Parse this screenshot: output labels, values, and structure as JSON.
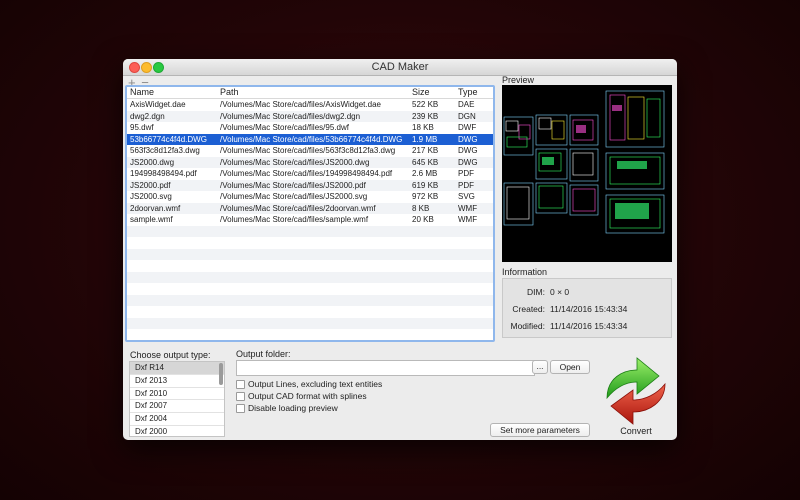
{
  "window": {
    "title": "CAD Maker",
    "toolbar": {
      "add_symbol": "+",
      "remove_symbol": "−"
    }
  },
  "file_table": {
    "columns": [
      "Name",
      "Path",
      "Size",
      "Type"
    ],
    "rows": [
      [
        "AxisWidget.dae",
        "/Volumes/Mac Store/cad/files/AxisWidget.dae",
        "522 KB",
        "DAE"
      ],
      [
        "dwg2.dgn",
        "/Volumes/Mac Store/cad/files/dwg2.dgn",
        "239 KB",
        "DGN"
      ],
      [
        "95.dwf",
        "/Volumes/Mac Store/cad/files/95.dwf",
        "18 KB",
        "DWF"
      ],
      [
        "53b66774c4f4d.DWG",
        "/Volumes/Mac Store/cad/files/53b66774c4f4d.DWG",
        "1.9 MB",
        "DWG"
      ],
      [
        "563f3c8d12fa3.dwg",
        "/Volumes/Mac Store/cad/files/563f3c8d12fa3.dwg",
        "217 KB",
        "DWG"
      ],
      [
        "JS2000.dwg",
        "/Volumes/Mac Store/cad/files/JS2000.dwg",
        "645 KB",
        "DWG"
      ],
      [
        "194998498494.pdf",
        "/Volumes/Mac Store/cad/files/194998498494.pdf",
        "2.6 MB",
        "PDF"
      ],
      [
        "JS2000.pdf",
        "/Volumes/Mac Store/cad/files/JS2000.pdf",
        "619 KB",
        "PDF"
      ],
      [
        "JS2000.svg",
        "/Volumes/Mac Store/cad/files/JS2000.svg",
        "972 KB",
        "SVG"
      ],
      [
        "2doorvan.wmf",
        "/Volumes/Mac Store/cad/files/2doorvan.wmf",
        "8 KB",
        "WMF"
      ],
      [
        "sample.wmf",
        "/Volumes/Mac Store/cad/files/sample.wmf",
        "20 KB",
        "WMF"
      ]
    ],
    "selected_row": 3,
    "empty_rows": 10
  },
  "preview": {
    "label": "Preview"
  },
  "information": {
    "label": "Information",
    "rows": [
      {
        "key": "DIM:",
        "value": "0 × 0"
      },
      {
        "key": "Created:",
        "value": "11/14/2016 15:43:34"
      },
      {
        "key": "Modified:",
        "value": "11/14/2016 15:43:34"
      }
    ]
  },
  "output_type": {
    "label": "Choose output type:",
    "options": [
      "Dxf R14",
      "Dxf 2013",
      "Dxf 2010",
      "Dxf 2007",
      "Dxf 2004",
      "Dxf 2000"
    ],
    "selected": 0
  },
  "output_folder": {
    "label": "Output folder:",
    "value": "",
    "browse_label": "...",
    "open_label": "Open"
  },
  "options": [
    {
      "label": "Output Lines, excluding text entities",
      "checked": false
    },
    {
      "label": "Output CAD format with splines",
      "checked": false
    },
    {
      "label": "Disable loading preview",
      "checked": false
    }
  ],
  "buttons": {
    "set_more_parameters": "Set more parameters",
    "convert": "Convert"
  },
  "colors": {
    "selection": "#1c5fd3",
    "table_focus_border": "#8fb7ec",
    "arrow_green": "#3fc22c",
    "arrow_red": "#d6281c"
  }
}
